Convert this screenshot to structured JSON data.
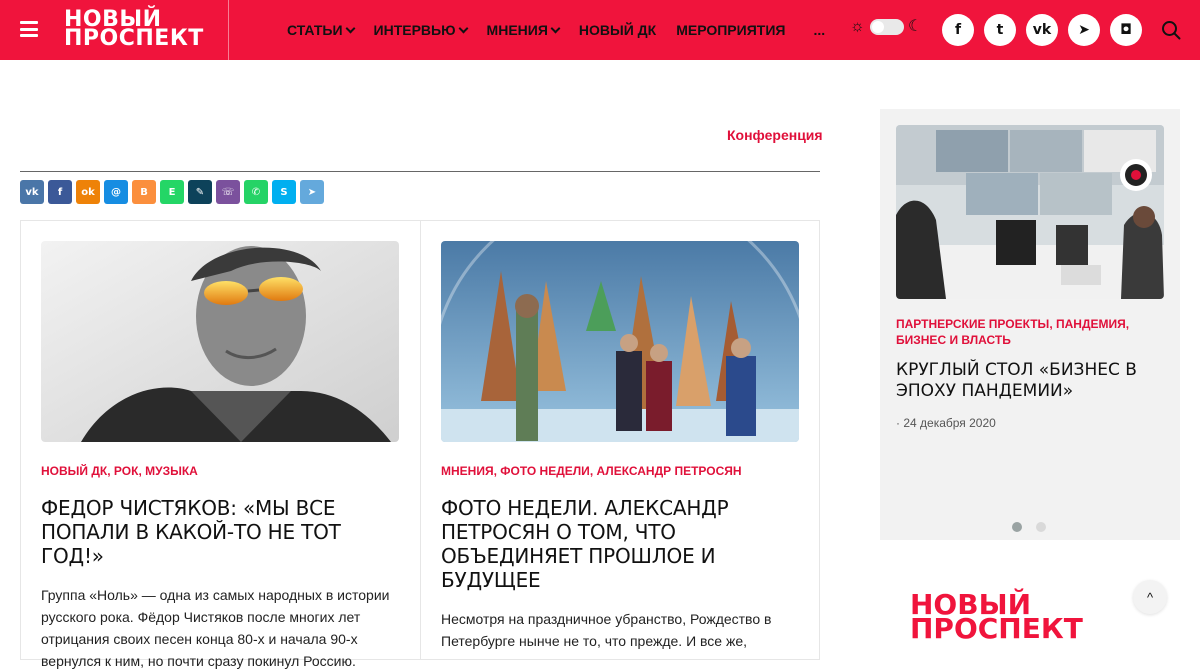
{
  "header": {
    "logo_line1": "НОВЫЙ",
    "logo_line2": "ПРОСПЕКТ",
    "nav": [
      {
        "label": "СТАТЬИ",
        "has_dropdown": true
      },
      {
        "label": "ИНТЕРВЬЮ",
        "has_dropdown": true
      },
      {
        "label": "МНЕНИЯ",
        "has_dropdown": true
      },
      {
        "label": "НОВЫЙ ДК",
        "has_dropdown": false
      },
      {
        "label": "МЕРОПРИЯТИЯ",
        "has_dropdown": false
      }
    ],
    "nav_more": "...",
    "socials": [
      {
        "icon": "facebook-icon",
        "glyph": "f"
      },
      {
        "icon": "twitter-icon",
        "glyph": "t"
      },
      {
        "icon": "vk-icon",
        "glyph": "vk"
      },
      {
        "icon": "telegram-icon",
        "glyph": "➤"
      },
      {
        "icon": "instagram-icon",
        "glyph": "◘"
      }
    ],
    "accent_color": "#f0143c"
  },
  "main": {
    "category_link": "Конференция",
    "share_buttons": [
      {
        "name": "vk",
        "color": "#4a76a8",
        "glyph": "vk"
      },
      {
        "name": "facebook",
        "color": "#3b5998",
        "glyph": "f"
      },
      {
        "name": "odnoklassniki",
        "color": "#ee8208",
        "glyph": "ok"
      },
      {
        "name": "moimir",
        "color": "#168de2",
        "glyph": "@"
      },
      {
        "name": "blogger",
        "color": "#fb8f3d",
        "glyph": "B"
      },
      {
        "name": "evernote",
        "color": "#24d666",
        "glyph": "E"
      },
      {
        "name": "livejournal",
        "color": "#0d425a",
        "glyph": "✎"
      },
      {
        "name": "viber",
        "color": "#7b519d",
        "glyph": "☏"
      },
      {
        "name": "whatsapp",
        "color": "#25d366",
        "glyph": "✆"
      },
      {
        "name": "skype",
        "color": "#00aff0",
        "glyph": "S"
      },
      {
        "name": "telegram",
        "color": "#64a9dc",
        "glyph": "➤"
      }
    ],
    "cards": [
      {
        "tags": [
          "НОВЫЙ ДК",
          "РОК",
          "МУЗЫКА"
        ],
        "title": "ФЕДОР ЧИСТЯКОВ: «МЫ ВСЕ ПОПАЛИ В КАКОЙ-ТО НЕ ТОТ ГОД!»",
        "excerpt": "Группа «Ноль» — одна из самых народных в истории русского рока. Фёдор Чистяков после многих лет отрицания своих песен конца 80-х и начала 90-х вернулся к ним, но почти сразу покинул Россию."
      },
      {
        "tags": [
          "МНЕНИЯ",
          "ФОТО НЕДЕЛИ",
          "АЛЕКСАНДР ПЕТРОСЯН"
        ],
        "title": "ФОТО НЕДЕЛИ. АЛЕКСАНДР ПЕТРОСЯН О ТОМ, ЧТО ОБЪЕДИНЯЕТ ПРОШЛОЕ И БУДУЩЕЕ",
        "excerpt": "Несмотря на праздничное убранство, Рождество в Петербурге нынче не то, что прежде. И все же,"
      }
    ]
  },
  "sidebar": {
    "slide": {
      "tags": [
        "ПАРТНЕРСКИЕ ПРОЕКТЫ",
        "ПАНДЕМИЯ",
        "БИЗНЕС И ВЛАСТЬ"
      ],
      "title": "КРУГЛЫЙ СТОЛ «БИЗНЕС В ЭПОХУ ПАНДЕМИИ»",
      "date": "24 декабря 2020",
      "date_prefix": "·"
    },
    "dots": [
      {
        "active": true
      },
      {
        "active": false
      }
    ],
    "logo_line1": "НОВЫЙ",
    "logo_line2": "ПРОСПЕКТ",
    "scroll_top": "^"
  }
}
